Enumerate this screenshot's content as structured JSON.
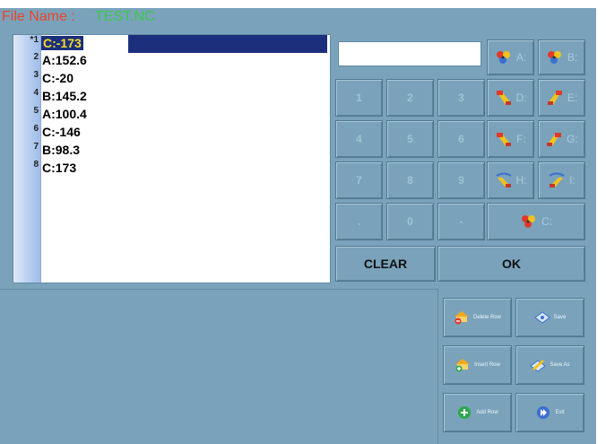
{
  "header": {
    "label": "File Name :",
    "value": "TEST.NC"
  },
  "program": {
    "rows": [
      {
        "num": "1",
        "text": "C:-173",
        "marker": "*"
      },
      {
        "num": "2",
        "text": "A:152.6"
      },
      {
        "num": "3",
        "text": "C:-20"
      },
      {
        "num": "4",
        "text": "B:145.2"
      },
      {
        "num": "5",
        "text": "A:100.4"
      },
      {
        "num": "6",
        "text": "C:-146"
      },
      {
        "num": "7",
        "text": "B:98.3"
      },
      {
        "num": "8",
        "text": "C:173"
      }
    ],
    "selected_index": 0
  },
  "keypad": {
    "input_value": "",
    "digits": [
      "1",
      "2",
      "3",
      "4",
      "5",
      "6",
      "7",
      "8",
      "9",
      ".",
      "0",
      "-"
    ],
    "axis_keys": [
      {
        "label": "A:",
        "icon": "robot-axis-a-icon"
      },
      {
        "label": "B:",
        "icon": "robot-axis-b-icon"
      },
      {
        "label": "D:",
        "icon": "robot-axis-d-icon"
      },
      {
        "label": "E:",
        "icon": "robot-axis-e-icon"
      },
      {
        "label": "F:",
        "icon": "robot-axis-f-icon"
      },
      {
        "label": "G:",
        "icon": "robot-axis-g-icon"
      },
      {
        "label": "H:",
        "icon": "robot-axis-h-icon"
      },
      {
        "label": "I:",
        "icon": "robot-axis-i-icon"
      },
      {
        "label": "C:",
        "icon": "robot-axis-c-icon"
      }
    ],
    "clear_label": "CLEAR",
    "ok_label": "OK"
  },
  "commands": {
    "delete_row": "Delete Row",
    "save": "Save",
    "insert_row": "Insert Row",
    "save_as": "Save As",
    "add_row": "Add Row",
    "exit": "Exit"
  },
  "colors": {
    "panel": "#7aa3bb",
    "selection": "#1c2f7c",
    "selected_text": "#f4d92d",
    "file_label": "#e8452c",
    "file_value": "#39c94a"
  }
}
